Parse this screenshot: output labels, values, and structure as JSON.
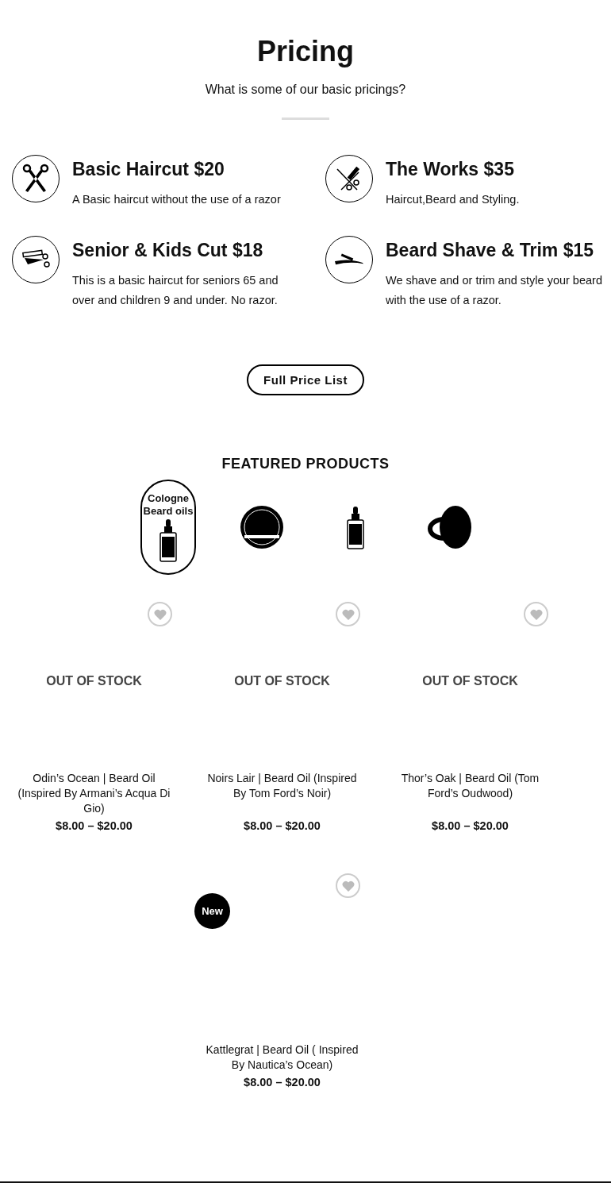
{
  "pricing": {
    "title": "Pricing",
    "subtitle": "What is some of our basic pricings?",
    "services": [
      {
        "kind": "scissors",
        "name": "Basic Haircut $20",
        "description": "A Basic haircut without the use of a razor"
      },
      {
        "kind": "scissors-comb",
        "name": "The Works $35",
        "description": "Haircut,Beard and Styling."
      },
      {
        "kind": "clippers",
        "name": "Senior & Kids Cut $18",
        "description": "This is a basic haircut for seniors 65 and over and children 9 and under. No razor."
      },
      {
        "kind": "razor",
        "name": "Beard Shave & Trim $15",
        "description": "We shave and or trim and style your beard with the use of a razor."
      }
    ],
    "button": "Full Price List"
  },
  "featured": {
    "title": "FEATURED PRODUCTS",
    "categories": [
      {
        "kind": "bottle",
        "labels": [
          "Cologne",
          "Beard oils"
        ],
        "selected": true
      },
      {
        "kind": "tin",
        "selected": false
      },
      {
        "kind": "bottle",
        "selected": false
      },
      {
        "kind": "open-tin",
        "selected": false
      }
    ],
    "products": [
      {
        "name": "Odin’s Ocean | Beard Oil (Inspired By Armani’s Acqua Di Gio)",
        "price": "$8.00 – $20.00",
        "stock": "OUT OF STOCK"
      },
      {
        "name": "Noirs Lair | Beard Oil (Inspired By Tom Ford’s Noir)",
        "price": "$8.00 – $20.00",
        "stock": "OUT OF STOCK"
      },
      {
        "name": "Thor’s Oak | Beard Oil (Tom Ford’s Oudwood)",
        "price": "$8.00 – $20.00",
        "stock": "OUT OF STOCK"
      },
      {
        "name": "Kattlegrat | Beard Oil ( Inspired By Nautica’s Ocean)",
        "price": "$8.00 – $20.00",
        "badge": "New"
      }
    ]
  }
}
